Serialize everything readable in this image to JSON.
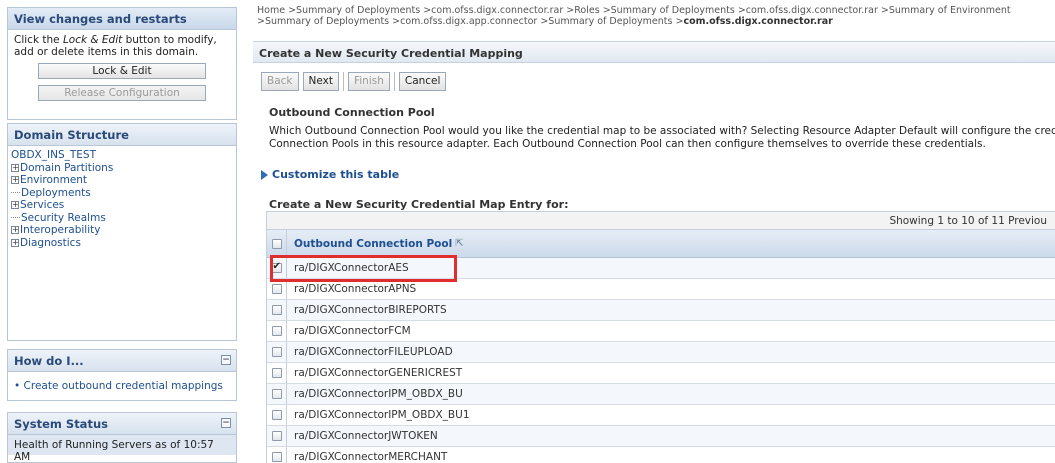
{
  "change_center": {
    "title": "View changes and restarts",
    "desc_prefix": "Click the ",
    "desc_italic": "Lock & Edit",
    "desc_suffix": " button to modify, add or delete items in this domain.",
    "lock_label": "Lock & Edit",
    "release_label": "Release Configuration"
  },
  "domain_structure": {
    "title": "Domain Structure",
    "root": "OBDX_INS_TEST",
    "items": [
      {
        "label": "Domain Partitions",
        "expandable": true
      },
      {
        "label": "Environment",
        "expandable": true
      },
      {
        "label": "Deployments",
        "expandable": false
      },
      {
        "label": "Services",
        "expandable": true
      },
      {
        "label": "Security Realms",
        "expandable": false
      },
      {
        "label": "Interoperability",
        "expandable": true
      },
      {
        "label": "Diagnostics",
        "expandable": true
      }
    ]
  },
  "how_do_i": {
    "title": "How do I...",
    "link": "Create outbound credential mappings"
  },
  "system_status": {
    "title": "System Status",
    "text": "Health of Running Servers as of  10:57 AM"
  },
  "breadcrumb": {
    "trail": "Home >Summary of Deployments >com.ofss.digx.connector.rar >Roles >Summary of Deployments >com.ofss.digx.connector.rar >Summary of Environment >Summary of Deployments >com.ofss.digx.app.connector >Summary of Deployments >",
    "current": "com.ofss.digx.connector.rar"
  },
  "page": {
    "title": "Create a New Security Credential Mapping",
    "buttons": {
      "back": "Back",
      "next": "Next",
      "finish": "Finish",
      "cancel": "Cancel"
    },
    "section_title": "Outbound Connection Pool",
    "section_desc_line1": "Which Outbound Connection Pool would you like the credential map to be associated with? Selecting Resource Adapter Default will configure the credential mapping for all Outbou",
    "section_desc_line2": "Connection Pools in this resource adapter. Each Outbound Connection Pool can then configure themselves to override these credentials.",
    "customize": "Customize this table",
    "table_caption": "Create a New Security Credential Map Entry for:",
    "pager": "Showing 1 to 10 of 11  Previou",
    "column_header": "Outbound Connection Pool",
    "rows": [
      {
        "name": "ra/DIGXConnectorAES",
        "checked": true
      },
      {
        "name": "ra/DIGXConnectorAPNS",
        "checked": false
      },
      {
        "name": "ra/DIGXConnectorBIREPORTS",
        "checked": false
      },
      {
        "name": "ra/DIGXConnectorFCM",
        "checked": false
      },
      {
        "name": "ra/DIGXConnectorFILEUPLOAD",
        "checked": false
      },
      {
        "name": "ra/DIGXConnectorGENERICREST",
        "checked": false
      },
      {
        "name": "ra/DIGXConnectorIPM_OBDX_BU",
        "checked": false
      },
      {
        "name": "ra/DIGXConnectorIPM_OBDX_BU1",
        "checked": false
      },
      {
        "name": "ra/DIGXConnectorJWTOKEN",
        "checked": false
      },
      {
        "name": "ra/DIGXConnectorMERCHANT",
        "checked": false
      }
    ]
  },
  "colors": {
    "highlight": "#e02e2e",
    "link": "#1d4f91"
  }
}
